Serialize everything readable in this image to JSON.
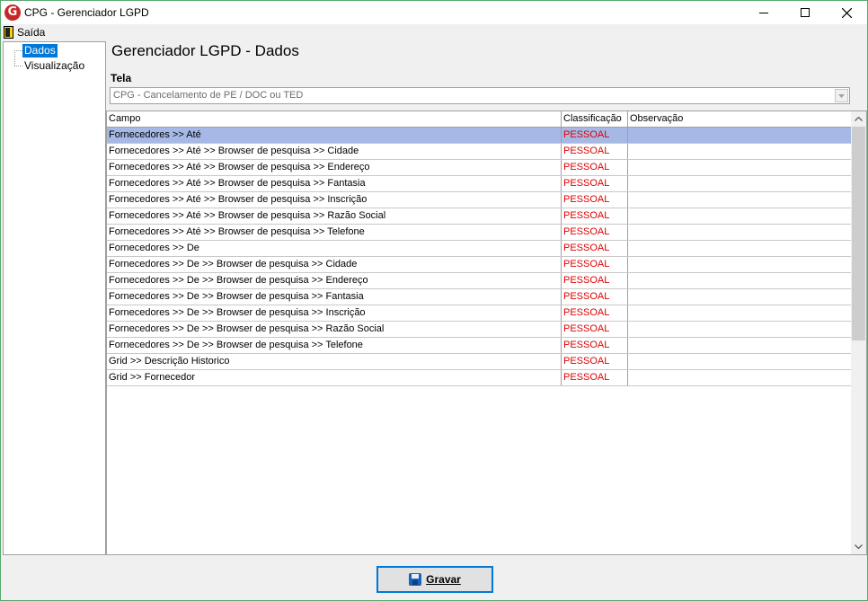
{
  "window": {
    "title": "CPG - Gerenciador LGPD",
    "icon": "cpg-logo-icon"
  },
  "menu": {
    "items": [
      {
        "label": "Saída",
        "icon": "exit-door-icon"
      }
    ]
  },
  "tree": {
    "items": [
      {
        "label": "Dados",
        "selected": true
      },
      {
        "label": "Visualização",
        "selected": false
      }
    ]
  },
  "main": {
    "title": "Gerenciador LGPD - Dados",
    "tela_label": "Tela",
    "tela_value": "CPG - Cancelamento de PE / DOC ou TED"
  },
  "grid": {
    "columns": [
      "Campo",
      "Classificação",
      "Observação"
    ],
    "rows": [
      {
        "campo": "Fornecedores >> Até",
        "classificacao": "PESSOAL",
        "observacao": ""
      },
      {
        "campo": "Fornecedores >> Até >> Browser de pesquisa >> Cidade",
        "classificacao": "PESSOAL",
        "observacao": ""
      },
      {
        "campo": "Fornecedores >> Até >> Browser de pesquisa >> Endereço",
        "classificacao": "PESSOAL",
        "observacao": ""
      },
      {
        "campo": "Fornecedores >> Até >> Browser de pesquisa >> Fantasia",
        "classificacao": "PESSOAL",
        "observacao": ""
      },
      {
        "campo": "Fornecedores >> Até >> Browser de pesquisa >> Inscrição",
        "classificacao": "PESSOAL",
        "observacao": ""
      },
      {
        "campo": "Fornecedores >> Até >> Browser de pesquisa >> Razão Social",
        "classificacao": "PESSOAL",
        "observacao": ""
      },
      {
        "campo": "Fornecedores >> Até >> Browser de pesquisa >> Telefone",
        "classificacao": "PESSOAL",
        "observacao": ""
      },
      {
        "campo": "Fornecedores >> De",
        "classificacao": "PESSOAL",
        "observacao": ""
      },
      {
        "campo": "Fornecedores >> De >> Browser de pesquisa >> Cidade",
        "classificacao": "PESSOAL",
        "observacao": ""
      },
      {
        "campo": "Fornecedores >> De >> Browser de pesquisa >> Endereço",
        "classificacao": "PESSOAL",
        "observacao": ""
      },
      {
        "campo": "Fornecedores >> De >> Browser de pesquisa >> Fantasia",
        "classificacao": "PESSOAL",
        "observacao": ""
      },
      {
        "campo": "Fornecedores >> De >> Browser de pesquisa >> Inscrição",
        "classificacao": "PESSOAL",
        "observacao": ""
      },
      {
        "campo": "Fornecedores >> De >> Browser de pesquisa >> Razão Social",
        "classificacao": "PESSOAL",
        "observacao": ""
      },
      {
        "campo": "Fornecedores >> De >> Browser de pesquisa >> Telefone",
        "classificacao": "PESSOAL",
        "observacao": ""
      },
      {
        "campo": "Grid >> Descrição Historico",
        "classificacao": "PESSOAL",
        "observacao": ""
      },
      {
        "campo": "Grid >> Fornecedor",
        "classificacao": "PESSOAL",
        "observacao": ""
      }
    ],
    "selected_row": 0
  },
  "footer": {
    "save_label": "Gravar",
    "save_icon": "floppy-disk-icon"
  },
  "colors": {
    "window_border": "#5aa86f",
    "selection": "#0078d7",
    "row_selection": "#a5b8e6",
    "classification_text": "#e00000"
  }
}
